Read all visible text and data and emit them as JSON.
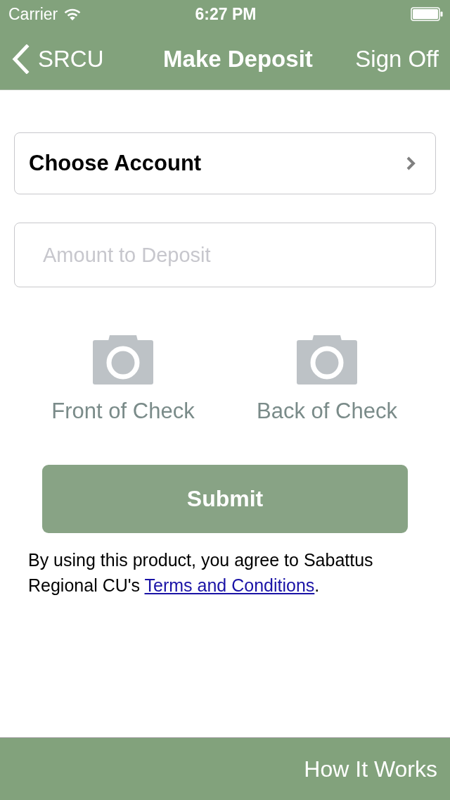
{
  "status_bar": {
    "carrier": "Carrier",
    "time": "6:27 PM"
  },
  "nav_bar": {
    "back": "SRCU",
    "title": "Make Deposit",
    "action": "Sign Off"
  },
  "account_picker": {
    "label": "Choose Account"
  },
  "amount_field": {
    "placeholder": "Amount to Deposit"
  },
  "photos": [
    {
      "label": "Front of Check"
    },
    {
      "label": "Back of Check"
    }
  ],
  "submit_button": {
    "label": "Submit"
  },
  "terms": {
    "text": "By using this product, you agree to Sabattus Regional CU's ",
    "link": "Terms and Conditions",
    "end": "."
  },
  "footer": {
    "link": "How It Works"
  }
}
